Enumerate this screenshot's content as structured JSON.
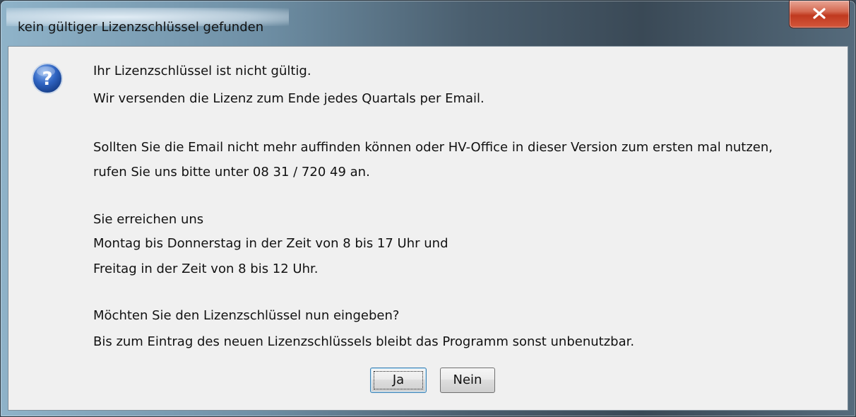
{
  "window": {
    "title": "kein gültiger Lizenzschlüssel gefunden"
  },
  "icons": {
    "close": "close-icon",
    "question": "question-icon"
  },
  "message": {
    "lines": [
      "Ihr Lizenzschlüssel ist nicht gültig.",
      "Wir versenden die Lizenz zum Ende jedes Quartals per Email.",
      "Sollten Sie die Email nicht mehr auffinden können oder HV-Office in dieser Version zum ersten mal nutzen,",
      "rufen Sie uns bitte unter 08 31 / 720 49 an.",
      "Sie erreichen uns",
      "Montag bis Donnerstag in der Zeit von 8 bis 17 Uhr und",
      "Freitag in der Zeit von 8 bis 12 Uhr.",
      "Möchten Sie den Lizenzschlüssel nun eingeben?",
      "Bis zum Eintrag des neuen Lizenzschlüssels bleibt das Programm sonst unbenutzbar."
    ]
  },
  "buttons": {
    "yes_label": "Ja",
    "no_label": "Nein"
  },
  "colors": {
    "dialog_background": "#f0f0f0",
    "close_button": "#c0391f",
    "question_icon": "#2b5fb8"
  }
}
